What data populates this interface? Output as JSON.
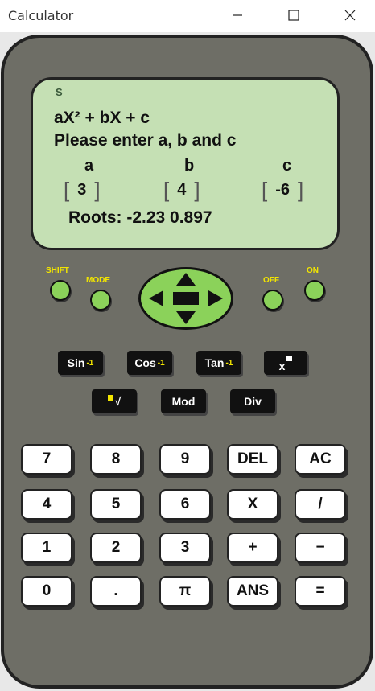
{
  "window": {
    "title": "Calculator"
  },
  "screen": {
    "shift_indicator": "S",
    "equation": "aX² + bX + c",
    "prompt": "Please enter a, b and c",
    "labels": [
      "a",
      "b",
      "c"
    ],
    "values": [
      "3",
      "4",
      "-6"
    ],
    "roots": "Roots: -2.23   0.897"
  },
  "controls": {
    "shift": "SHIFT",
    "mode": "MODE",
    "off": "OFF",
    "on": "ON"
  },
  "functions": {
    "sin": "Sin",
    "cos": "Cos",
    "tan": "Tan",
    "inv": "-1",
    "power": "x",
    "root": "√",
    "mod": "Mod",
    "div": "Div"
  },
  "keys": {
    "row1": [
      "7",
      "8",
      "9",
      "DEL",
      "AC"
    ],
    "row2": [
      "4",
      "5",
      "6",
      "X",
      "/"
    ],
    "row3": [
      "1",
      "2",
      "3",
      "+",
      "−"
    ],
    "row4": [
      "0",
      ".",
      "π",
      "ANS",
      "="
    ]
  },
  "colors": {
    "screen": "#c5e0b4",
    "body": "#6e6e66",
    "green_button": "#8bd25a",
    "label_yellow": "#f2e500"
  }
}
